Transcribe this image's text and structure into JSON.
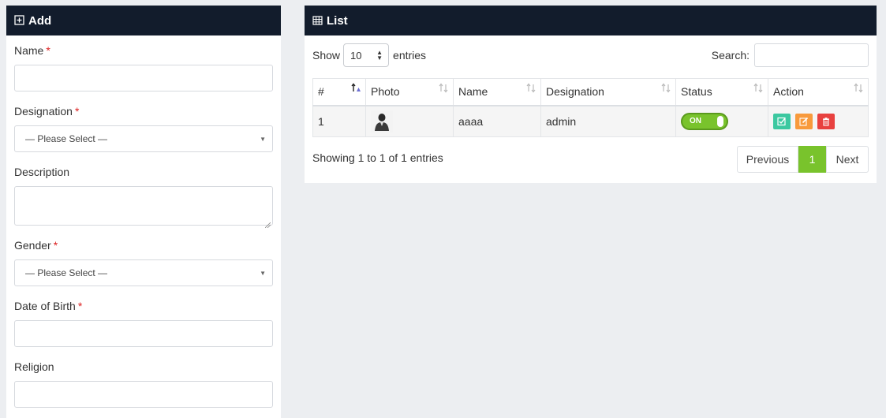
{
  "add_panel": {
    "title": "Add",
    "fields": {
      "name": {
        "label": "Name",
        "required": "*",
        "value": ""
      },
      "designation": {
        "label": "Designation",
        "required": "*",
        "value": "— Please Select —"
      },
      "description": {
        "label": "Description",
        "value": ""
      },
      "gender": {
        "label": "Gender",
        "required": "*",
        "value": "— Please Select —"
      },
      "dob": {
        "label": "Date of Birth",
        "required": "*",
        "value": ""
      },
      "religion": {
        "label": "Religion",
        "value": ""
      }
    }
  },
  "list_panel": {
    "title": "List",
    "show_label": "Show",
    "entries_value": "10",
    "entries_label": "entries",
    "search_label": "Search:",
    "search_value": "",
    "columns": [
      "#",
      "Photo",
      "Name",
      "Designation",
      "Status",
      "Action"
    ],
    "rows": [
      {
        "num": "1",
        "photo_icon": "user-avatar-icon",
        "name": "aaaa",
        "designation": "admin",
        "status": "ON"
      }
    ],
    "info": "Showing 1 to 1 of 1 entries",
    "pagination": {
      "prev": "Previous",
      "current": "1",
      "next": "Next"
    }
  },
  "colors": {
    "header_bg": "#121c2c",
    "accent_green": "#79c32c",
    "action_check": "#3cc8a0",
    "action_edit": "#f89a3c",
    "action_delete": "#e8413f",
    "required": "#dd2222"
  }
}
